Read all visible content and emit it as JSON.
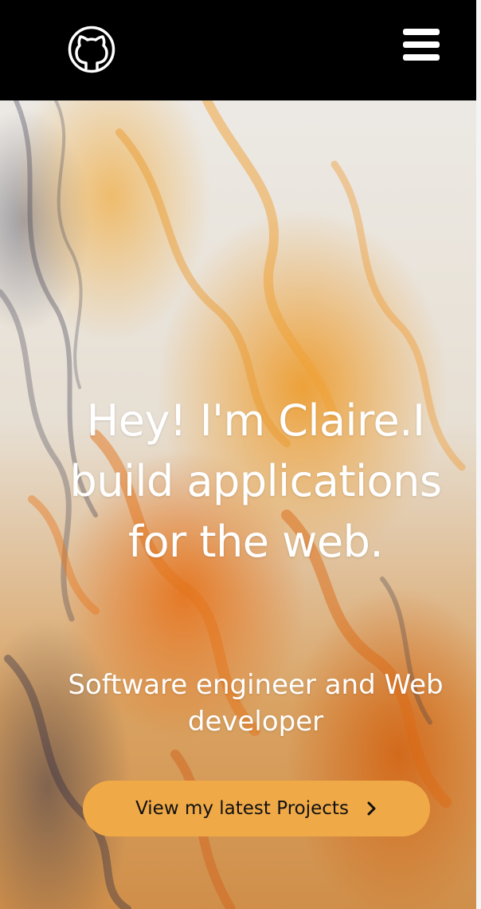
{
  "nav": {
    "logo_icon": "github-icon",
    "menu_icon": "hamburger-menu-icon"
  },
  "hero": {
    "headline": "Hey! I'm Claire.I build applications for the web.",
    "subheadline": "Software engineer and Web developer",
    "cta_label": "View my latest Projects",
    "cta_icon": "chevron-right-icon"
  },
  "colors": {
    "navbar": "#000000",
    "accent": "#f0a947",
    "text_light": "#ffffff"
  }
}
